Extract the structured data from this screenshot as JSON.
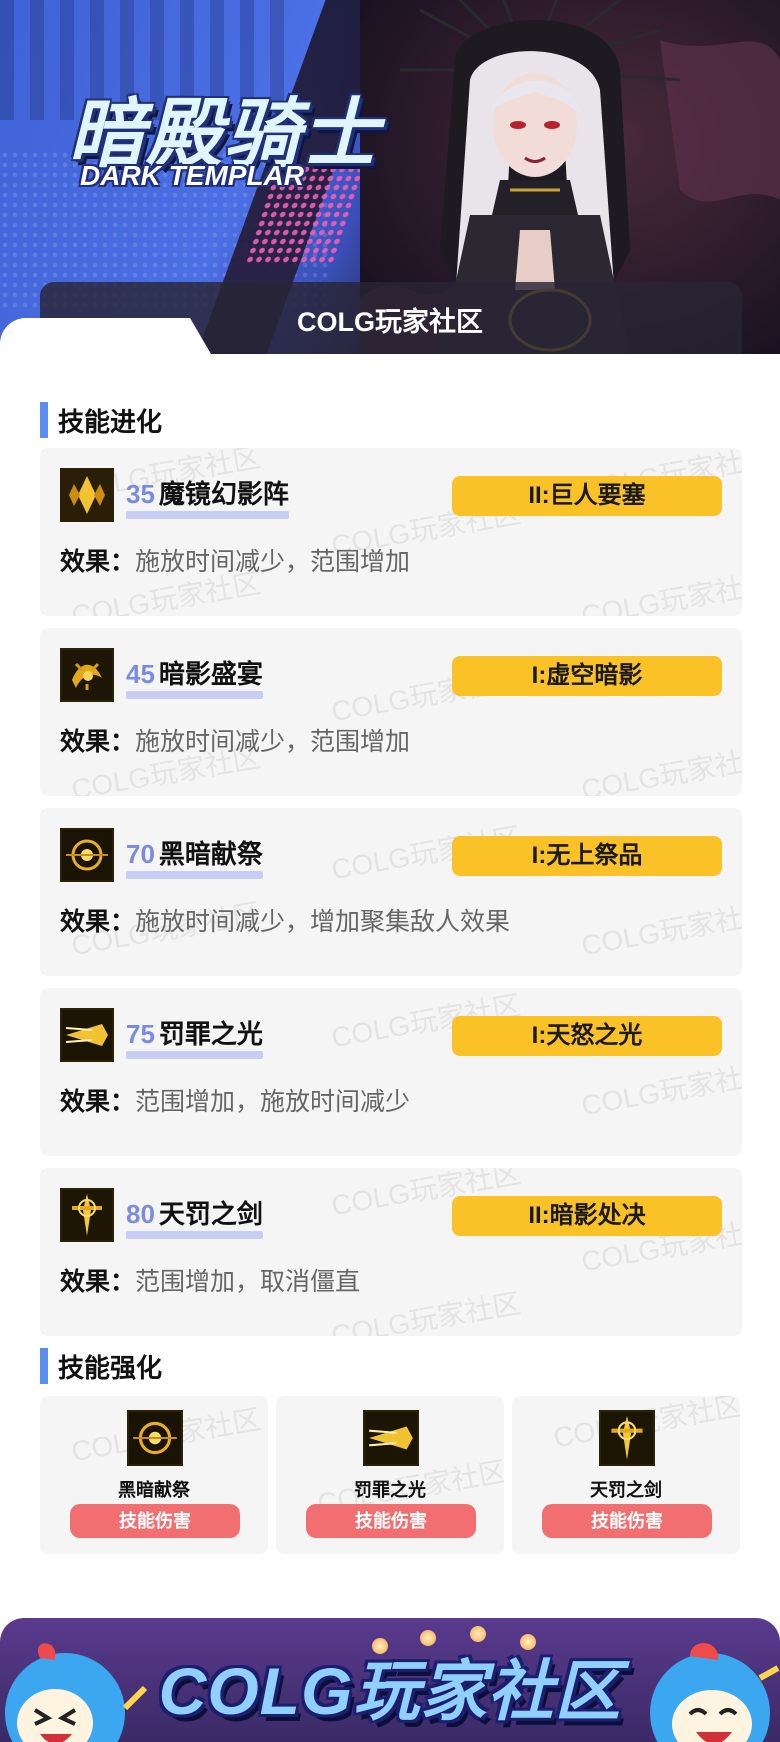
{
  "banner": {
    "title_cn": "暗殿骑士",
    "title_en": "DARK TEMPLAR",
    "community": "COLG玩家社区"
  },
  "watermark": "COLG玩家社区",
  "evolution": {
    "title": "技能进化",
    "effect_label": "效果：",
    "items": [
      {
        "level": "35",
        "name": "魔镜幻影阵",
        "tag": "II:巨人要塞",
        "effect": "施放时间减少，范围增加"
      },
      {
        "level": "45",
        "name": "暗影盛宴",
        "tag": "I:虚空暗影",
        "effect": "施放时间减少，范围增加"
      },
      {
        "level": "70",
        "name": "黑暗献祭",
        "tag": "I:无上祭品",
        "effect": "施放时间减少，增加聚集敌人效果"
      },
      {
        "level": "75",
        "name": "罚罪之光",
        "tag": "I:天怒之光",
        "effect": "范围增加，施放时间减少"
      },
      {
        "level": "80",
        "name": "天罚之剑",
        "tag": "II:暗影处决",
        "effect": "范围增加，取消僵直"
      }
    ]
  },
  "enhancement": {
    "title": "技能强化",
    "items": [
      {
        "name": "黑暗献祭",
        "button": "技能伤害"
      },
      {
        "name": "罚罪之光",
        "button": "技能伤害"
      },
      {
        "name": "天罚之剑",
        "button": "技能伤害"
      }
    ]
  },
  "footer": {
    "brand": "COLG玩家社区"
  },
  "colors": {
    "accent_blue": "#5a8ff0",
    "level_blue": "#7b8be0",
    "tag_yellow": "#fbc228",
    "button_red": "#f26f71",
    "card_bg": "#f5f5f5"
  },
  "icons": [
    "mirror-phantom-skill-icon",
    "shadow-feast-skill-icon",
    "dark-sacrifice-skill-icon",
    "punishment-light-skill-icon",
    "heaven-sword-skill-icon"
  ]
}
